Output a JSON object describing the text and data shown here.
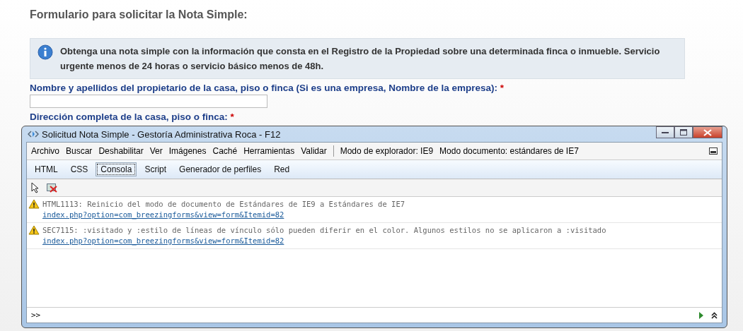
{
  "page": {
    "heading": "Formulario para solicitar la Nota Simple:",
    "info": "Obtenga una nota simple con la información que consta en el Registro de la Propiedad sobre una determinada finca o inmueble. Servicio urgente menos de 24 horas o servicio básico menos de 48h.",
    "fields": [
      {
        "label": "Nombre y apellidos del propietario de la casa, piso o finca (Si es una empresa, Nombre de la empresa):",
        "required_mark": "*",
        "kind": "input"
      },
      {
        "label": "Dirección completa de la casa, piso o finca:",
        "required_mark": "*",
        "kind": "label"
      }
    ]
  },
  "devtools": {
    "title": "Solicitud Nota Simple - Gestoría Administrativa Roca - F12",
    "menu": [
      "Archivo",
      "Buscar",
      "Deshabilitar",
      "Ver",
      "Imágenes",
      "Caché",
      "Herramientas",
      "Validar"
    ],
    "modes": [
      "Modo de explorador: IE9",
      "Modo documento:  estándares de IE7"
    ],
    "tabs": [
      {
        "label": "HTML",
        "selected": false
      },
      {
        "label": "CSS",
        "selected": false
      },
      {
        "label": "Consola",
        "selected": true
      },
      {
        "label": "Script",
        "selected": false
      },
      {
        "label": "Generador de perfiles",
        "selected": false
      },
      {
        "label": "Red",
        "selected": false
      }
    ],
    "messages": [
      {
        "kind": "warning",
        "text": "HTML1113: Reinicio del modo de documento de Estándares de IE9 a Estándares de IE7",
        "link": "index.php?option=com_breezingforms&view=form&Itemid=82"
      },
      {
        "kind": "warning",
        "text": "SEC7115: :visitado y :estilo de líneas de vínculo sólo pueden diferir en el color. Algunos estilos no se aplicaron a :visitado",
        "link": "index.php?option=com_breezingforms&view=form&Itemid=82"
      }
    ],
    "prompt": ">>"
  }
}
